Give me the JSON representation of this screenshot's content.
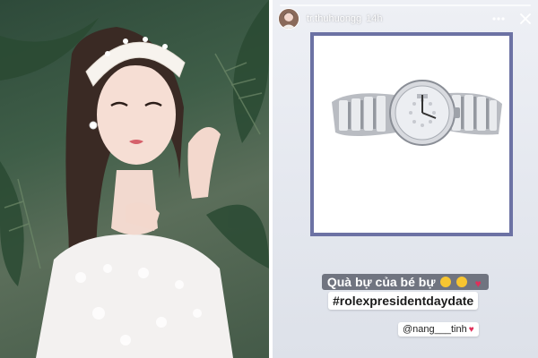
{
  "story": {
    "username": "tr.thuhuongg",
    "time_ago": "14h",
    "caption": "Quà bự của bé bự",
    "caption_emojis": [
      "smirk-emoji",
      "smirk-emoji",
      "red-heart-emoji"
    ],
    "hashtag": "#rolexpresidentdaydate",
    "mention": "@nang___tinh",
    "mention_heart": "♥",
    "frame_color": "#6c72a4"
  },
  "icons": {
    "more": "more-dots-icon",
    "close": "close-icon"
  }
}
